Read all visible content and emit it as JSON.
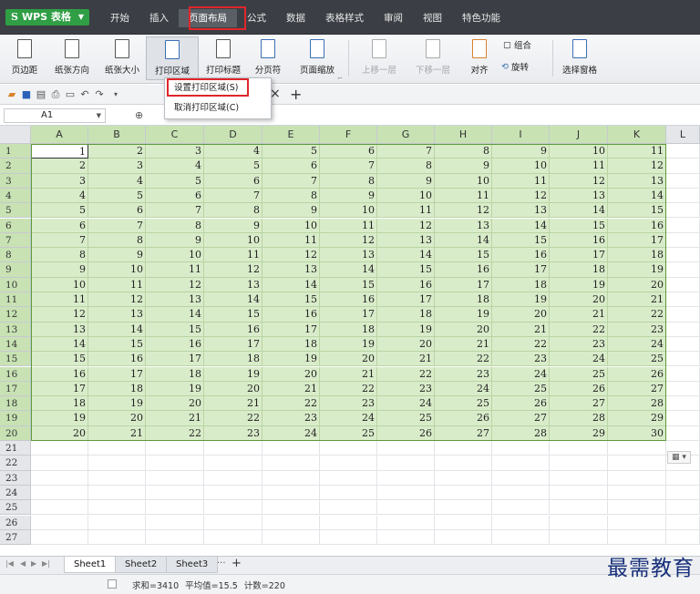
{
  "app": {
    "name": "WPS 表格",
    "logo": "S"
  },
  "menu": [
    "开始",
    "插入",
    "页面布局",
    "公式",
    "数据",
    "表格样式",
    "审阅",
    "视图",
    "特色功能"
  ],
  "ribbon": {
    "margin": "页边距",
    "orientation": "纸张方向",
    "size": "纸张大小",
    "print_area": "打印区域",
    "print_titles": "打印标题",
    "page_break": "分页符",
    "scale": "页面缩放",
    "bring_forward": "上移一层",
    "send_backward": "下移一层",
    "align": "对齐",
    "group": "组合",
    "rotate": "旋转",
    "selection_pane": "选择窗格"
  },
  "dropdown": {
    "set": "设置打印区域(S)",
    "cancel": "取消打印区域(C)"
  },
  "namebox": "A1",
  "columns": [
    "A",
    "B",
    "C",
    "D",
    "E",
    "F",
    "G",
    "H",
    "I",
    "J",
    "K",
    "L"
  ],
  "rows": [
    [
      1,
      2,
      3,
      4,
      5,
      6,
      7,
      8,
      9,
      10,
      11
    ],
    [
      2,
      3,
      4,
      5,
      6,
      7,
      8,
      9,
      10,
      11,
      12
    ],
    [
      3,
      4,
      5,
      6,
      7,
      8,
      9,
      10,
      11,
      12,
      13
    ],
    [
      4,
      5,
      6,
      7,
      8,
      9,
      10,
      11,
      12,
      13,
      14
    ],
    [
      5,
      6,
      7,
      8,
      9,
      10,
      11,
      12,
      13,
      14,
      15
    ],
    [
      6,
      7,
      8,
      9,
      10,
      11,
      12,
      13,
      14,
      15,
      16
    ],
    [
      7,
      8,
      9,
      10,
      11,
      12,
      13,
      14,
      15,
      16,
      17
    ],
    [
      8,
      9,
      10,
      11,
      12,
      13,
      14,
      15,
      16,
      17,
      18
    ],
    [
      9,
      10,
      11,
      12,
      13,
      14,
      15,
      16,
      17,
      18,
      19
    ],
    [
      10,
      11,
      12,
      13,
      14,
      15,
      16,
      17,
      18,
      19,
      20
    ],
    [
      11,
      12,
      13,
      14,
      15,
      16,
      17,
      18,
      19,
      20,
      21
    ],
    [
      12,
      13,
      14,
      15,
      16,
      17,
      18,
      19,
      20,
      21,
      22
    ],
    [
      13,
      14,
      15,
      16,
      17,
      18,
      19,
      20,
      21,
      22,
      23
    ],
    [
      14,
      15,
      16,
      17,
      18,
      19,
      20,
      21,
      22,
      23,
      24
    ],
    [
      15,
      16,
      17,
      18,
      19,
      20,
      21,
      22,
      23,
      24,
      25
    ],
    [
      16,
      17,
      18,
      19,
      20,
      21,
      22,
      23,
      24,
      25,
      26
    ],
    [
      17,
      18,
      19,
      20,
      21,
      22,
      23,
      24,
      25,
      26,
      27
    ],
    [
      18,
      19,
      20,
      21,
      22,
      23,
      24,
      25,
      26,
      27,
      28
    ],
    [
      19,
      20,
      21,
      22,
      23,
      24,
      25,
      26,
      27,
      28,
      29
    ],
    [
      20,
      21,
      22,
      23,
      24,
      25,
      26,
      27,
      28,
      29,
      30
    ]
  ],
  "row_numbers": [
    1,
    2,
    3,
    4,
    5,
    6,
    7,
    8,
    9,
    10,
    11,
    12,
    13,
    14,
    15,
    16,
    17,
    18,
    19,
    20,
    21,
    22,
    23,
    24,
    25,
    26,
    27
  ],
  "sheets": [
    "Sheet1",
    "Sheet2",
    "Sheet3"
  ],
  "sheet_more": "···",
  "status": "求和=3410  平均值=15.5  计数=220",
  "watermark": "最需教育",
  "colors": {
    "titlebar": "#3b3f45",
    "selection": "#d9ecca",
    "highlight": "#e0262c",
    "brand": "#2f9e44"
  }
}
